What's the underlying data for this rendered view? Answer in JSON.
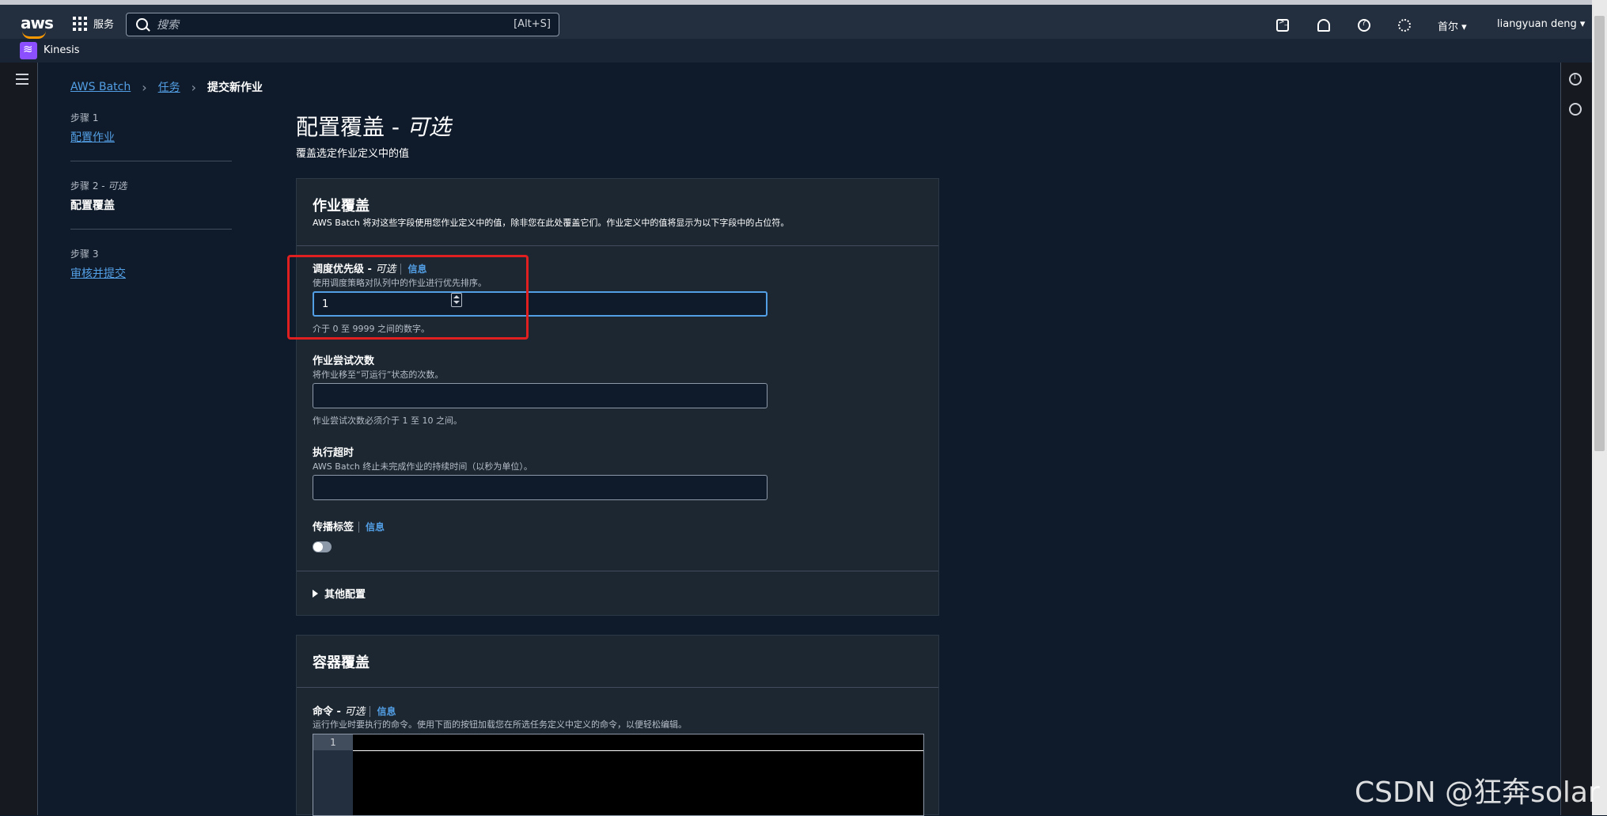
{
  "topbar": {
    "logo": "aws",
    "services_label": "服务",
    "search_placeholder": "搜索",
    "search_shortcut": "[Alt+S]",
    "region": "首尔 ▾",
    "user": "liangyuan deng ▾"
  },
  "service_bar": {
    "label": "Kinesis"
  },
  "breadcrumb": {
    "items": [
      "AWS Batch",
      "任务"
    ],
    "current": "提交新作业"
  },
  "steps": [
    {
      "label": "步骤 1",
      "value": "配置作业"
    },
    {
      "label": "步骤 2 - ",
      "label_em": "可选",
      "value": "配置覆盖"
    },
    {
      "label": "步骤 3",
      "value": "审核并提交"
    }
  ],
  "page": {
    "title": "配置覆盖 - ",
    "title_em": "可选",
    "subtitle": "覆盖选定作业定义中的值"
  },
  "job_override": {
    "title": "作业覆盖",
    "description": "AWS Batch 将对这些字段使用您作业定义中的值，除非您在此处覆盖它们。作业定义中的值将显示为以下字段中的占位符。",
    "priority": {
      "label": "调度优先级 - ",
      "label_em": "可选",
      "info": "信息",
      "description": "使用调度策略对队列中的作业进行优先排序。",
      "value": "1",
      "hint": "介于 0 至 9999 之间的数字。"
    },
    "attempts": {
      "label": "作业尝试次数",
      "description": "将作业移至“可运行”状态的次数。",
      "value": "",
      "hint": "作业尝试次数必须介于 1 至 10 之间。"
    },
    "timeout": {
      "label": "执行超时",
      "description": "AWS Batch 终止未完成作业的持续时间（以秒为单位）。",
      "value": ""
    },
    "propagate_tags": {
      "label": "传播标签",
      "info": "信息",
      "enabled": false
    },
    "other_config": "其他配置"
  },
  "container_override": {
    "title": "容器覆盖",
    "command": {
      "label": "命令 - ",
      "label_em": "可选",
      "info": "信息",
      "description": "运行作业时要执行的命令。使用下面的按钮加载您在所选任务定义中定义的命令，以便轻松编辑。",
      "line_number": "1"
    }
  },
  "watermark": "CSDN @狂奔solar"
}
